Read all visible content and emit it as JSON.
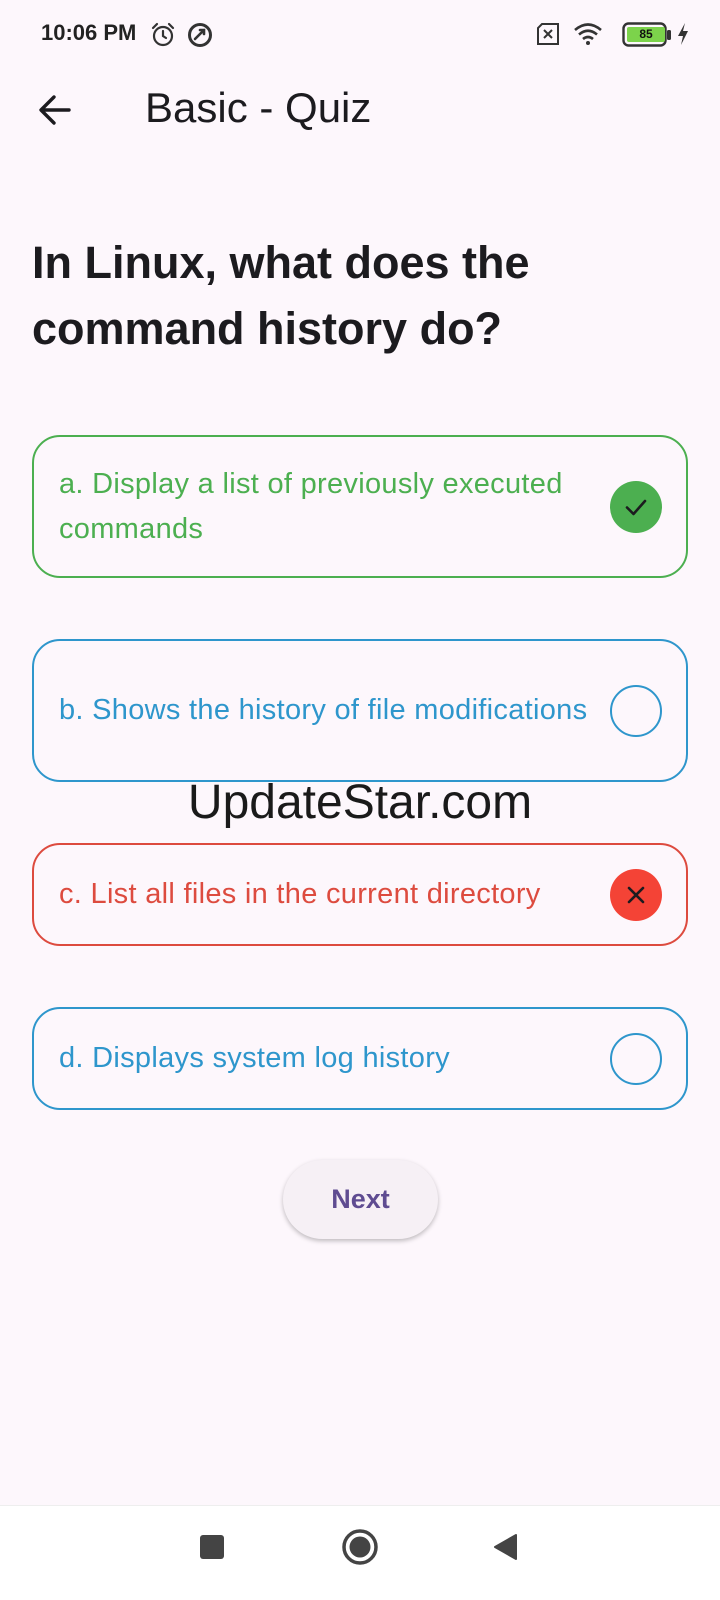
{
  "status_bar": {
    "time": "10:06 PM",
    "battery": "85",
    "icons": [
      "alarm-icon",
      "app-notification-icon",
      "no-sim-icon",
      "wifi-icon",
      "battery-icon",
      "charging-icon"
    ]
  },
  "app_bar": {
    "title": "Basic - Quiz",
    "back_icon": "arrow-back-icon"
  },
  "question": "In Linux, what does the command history do?",
  "options": [
    {
      "label": "a. Display a list of previously executed commands",
      "state": "correct",
      "icon": "check-icon",
      "color": "#4caf50"
    },
    {
      "label": "b. Shows the history of file modifications",
      "state": "unselected",
      "icon": "empty-circle-icon",
      "color": "#2e96cc"
    },
    {
      "label": "c. List all files in the current directory",
      "state": "wrong",
      "icon": "close-icon",
      "color": "#dd4b3f"
    },
    {
      "label": "d. Displays system log history",
      "state": "unselected",
      "icon": "empty-circle-icon",
      "color": "#2e96cc"
    }
  ],
  "watermark": "UpdateStar.com",
  "next_label": "Next",
  "nav_bar": {
    "icons": [
      "recents-icon",
      "home-icon",
      "back-triangle-icon"
    ]
  }
}
